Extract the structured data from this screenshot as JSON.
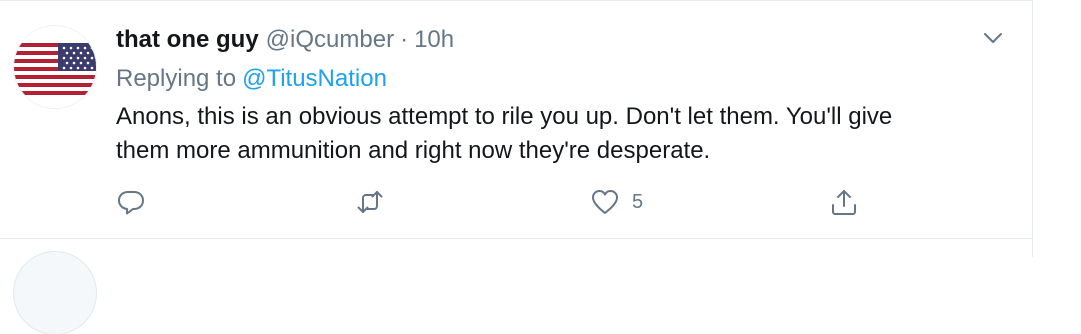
{
  "tweet": {
    "display_name": "that one guy",
    "handle": "@iQcumber",
    "separator": "·",
    "time": "10h",
    "replying_prefix": "Replying to",
    "replying_to": "@TitusNation",
    "text": "Anons, this is an obvious attempt to rile you up. Don't let them. You'll give\nthem more ammunition and right now they're desperate.",
    "actions": {
      "reply_icon": "reply-icon",
      "retweet_icon": "retweet-icon",
      "like_icon": "heart-icon",
      "like_count": "5",
      "share_icon": "share-icon"
    },
    "avatar": "us-flag-avatar"
  },
  "colors": {
    "text": "#14171a",
    "secondary": "#657786",
    "link": "#1da1f2",
    "divider": "#e6ecf0",
    "flag_red": "#b22234",
    "flag_blue": "#3c3b6e"
  }
}
